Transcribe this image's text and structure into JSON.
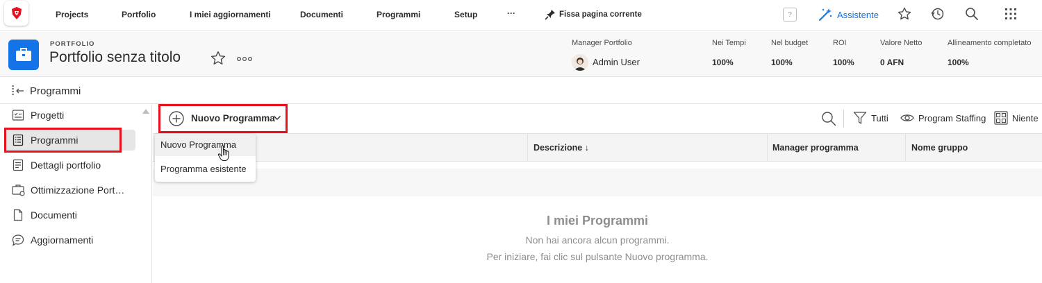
{
  "topnav": {
    "items": [
      "Projects",
      "Portfolio",
      "I miei aggiornamenti",
      "Documenti",
      "Programmi",
      "Setup"
    ],
    "more_label": "···",
    "pin_label": "Fissa pagina corrente",
    "help_label": "?",
    "assistant_label": "Assistente"
  },
  "header": {
    "kicker": "PORTFOLIO",
    "title": "Portfolio senza titolo",
    "more_label": "ooo",
    "manager": {
      "label": "Manager Portfolio",
      "name": "Admin User"
    },
    "metrics": [
      {
        "label": "Nei Tempi",
        "value": "100%"
      },
      {
        "label": "Nel budget",
        "value": "100%"
      },
      {
        "label": "ROI",
        "value": "100%"
      },
      {
        "label": "Valore Netto",
        "value": "0 AFN"
      },
      {
        "label": "Allineamento completato",
        "value": "100%"
      }
    ]
  },
  "breadcrumb": {
    "label": "Programmi"
  },
  "sidebar": {
    "items": [
      {
        "label": "Progetti",
        "icon": "projects-icon"
      },
      {
        "label": "Programmi",
        "icon": "programs-icon",
        "active": true
      },
      {
        "label": "Dettagli portfolio",
        "icon": "details-icon"
      },
      {
        "label": "Ottimizzazione Port…",
        "icon": "optimizer-icon"
      },
      {
        "label": "Documenti",
        "icon": "document-icon"
      },
      {
        "label": "Aggiornamenti",
        "icon": "updates-icon"
      }
    ]
  },
  "toolbar": {
    "new_label": "Nuovo Programma",
    "filter_label": "Tutti",
    "view_label": "Program Staffing",
    "group_label": "Niente"
  },
  "table": {
    "columns": [
      "Descrizione ↓",
      "Manager programma",
      "Nome gruppo"
    ]
  },
  "dropdown": {
    "options": [
      "Nuovo Programma",
      "Programma esistente"
    ]
  },
  "empty_state": {
    "title": "I miei Programmi",
    "line1": "Non hai ancora alcun programmi.",
    "line2": "Per iniziare, fai clic sul pulsante Nuovo programma."
  },
  "colors": {
    "accent": "#1473e6",
    "highlight_border": "#e8101d",
    "brand_red": "#e8101d"
  }
}
